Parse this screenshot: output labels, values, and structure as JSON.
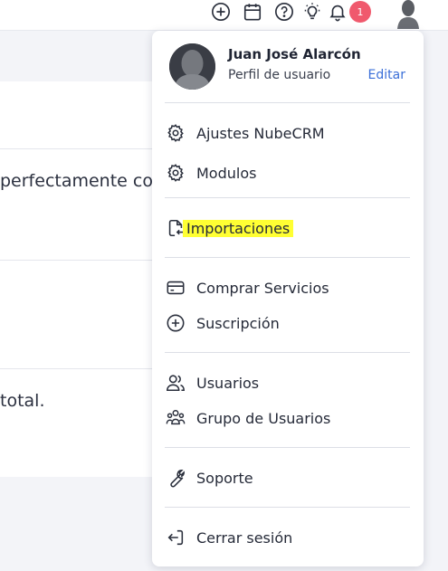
{
  "colors": {
    "accent": "#3b6fd8",
    "badge": "#f0596d",
    "highlight": "#ffff33"
  },
  "topbar": {
    "icons": [
      "plus-circle-icon",
      "calendar-icon",
      "help-icon",
      "lightbulb-icon",
      "bell-icon"
    ],
    "notification_count": "1"
  },
  "background": {
    "text_1": "perfectamente co",
    "text_2": "total."
  },
  "profile": {
    "name": "Juan José Alarcón",
    "subtitle": "Perfil de usuario",
    "edit_label": "Editar"
  },
  "menu": {
    "settings": "Ajustes NubeCRM",
    "modules": "Modulos",
    "imports": "Importaciones",
    "buy_services": "Comprar Servicios",
    "subscription": "Suscripción",
    "users": "Usuarios",
    "user_groups": "Grupo de Usuarios",
    "support": "Soporte",
    "logout": "Cerrar sesión"
  }
}
